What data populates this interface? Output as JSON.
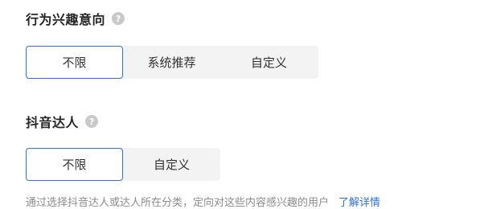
{
  "behavior_interest": {
    "title": "行为兴趣意向",
    "help_icon": "?",
    "options": [
      "不限",
      "系统推荐",
      "自定义"
    ],
    "selected": "不限"
  },
  "douyin_creator": {
    "title": "抖音达人",
    "help_icon": "?",
    "options": [
      "不限",
      "自定义"
    ],
    "selected": "不限"
  },
  "hint": {
    "text": "通过选择抖音达人或达人所在分类，定向对这些内容感兴趣的用户",
    "link": "了解详情"
  },
  "colors": {
    "accent": "#2f6ee8",
    "segment_bg": "#f3f3f3",
    "help_icon_bg": "#c9c9c9",
    "hint_text": "#8c8c8c"
  }
}
